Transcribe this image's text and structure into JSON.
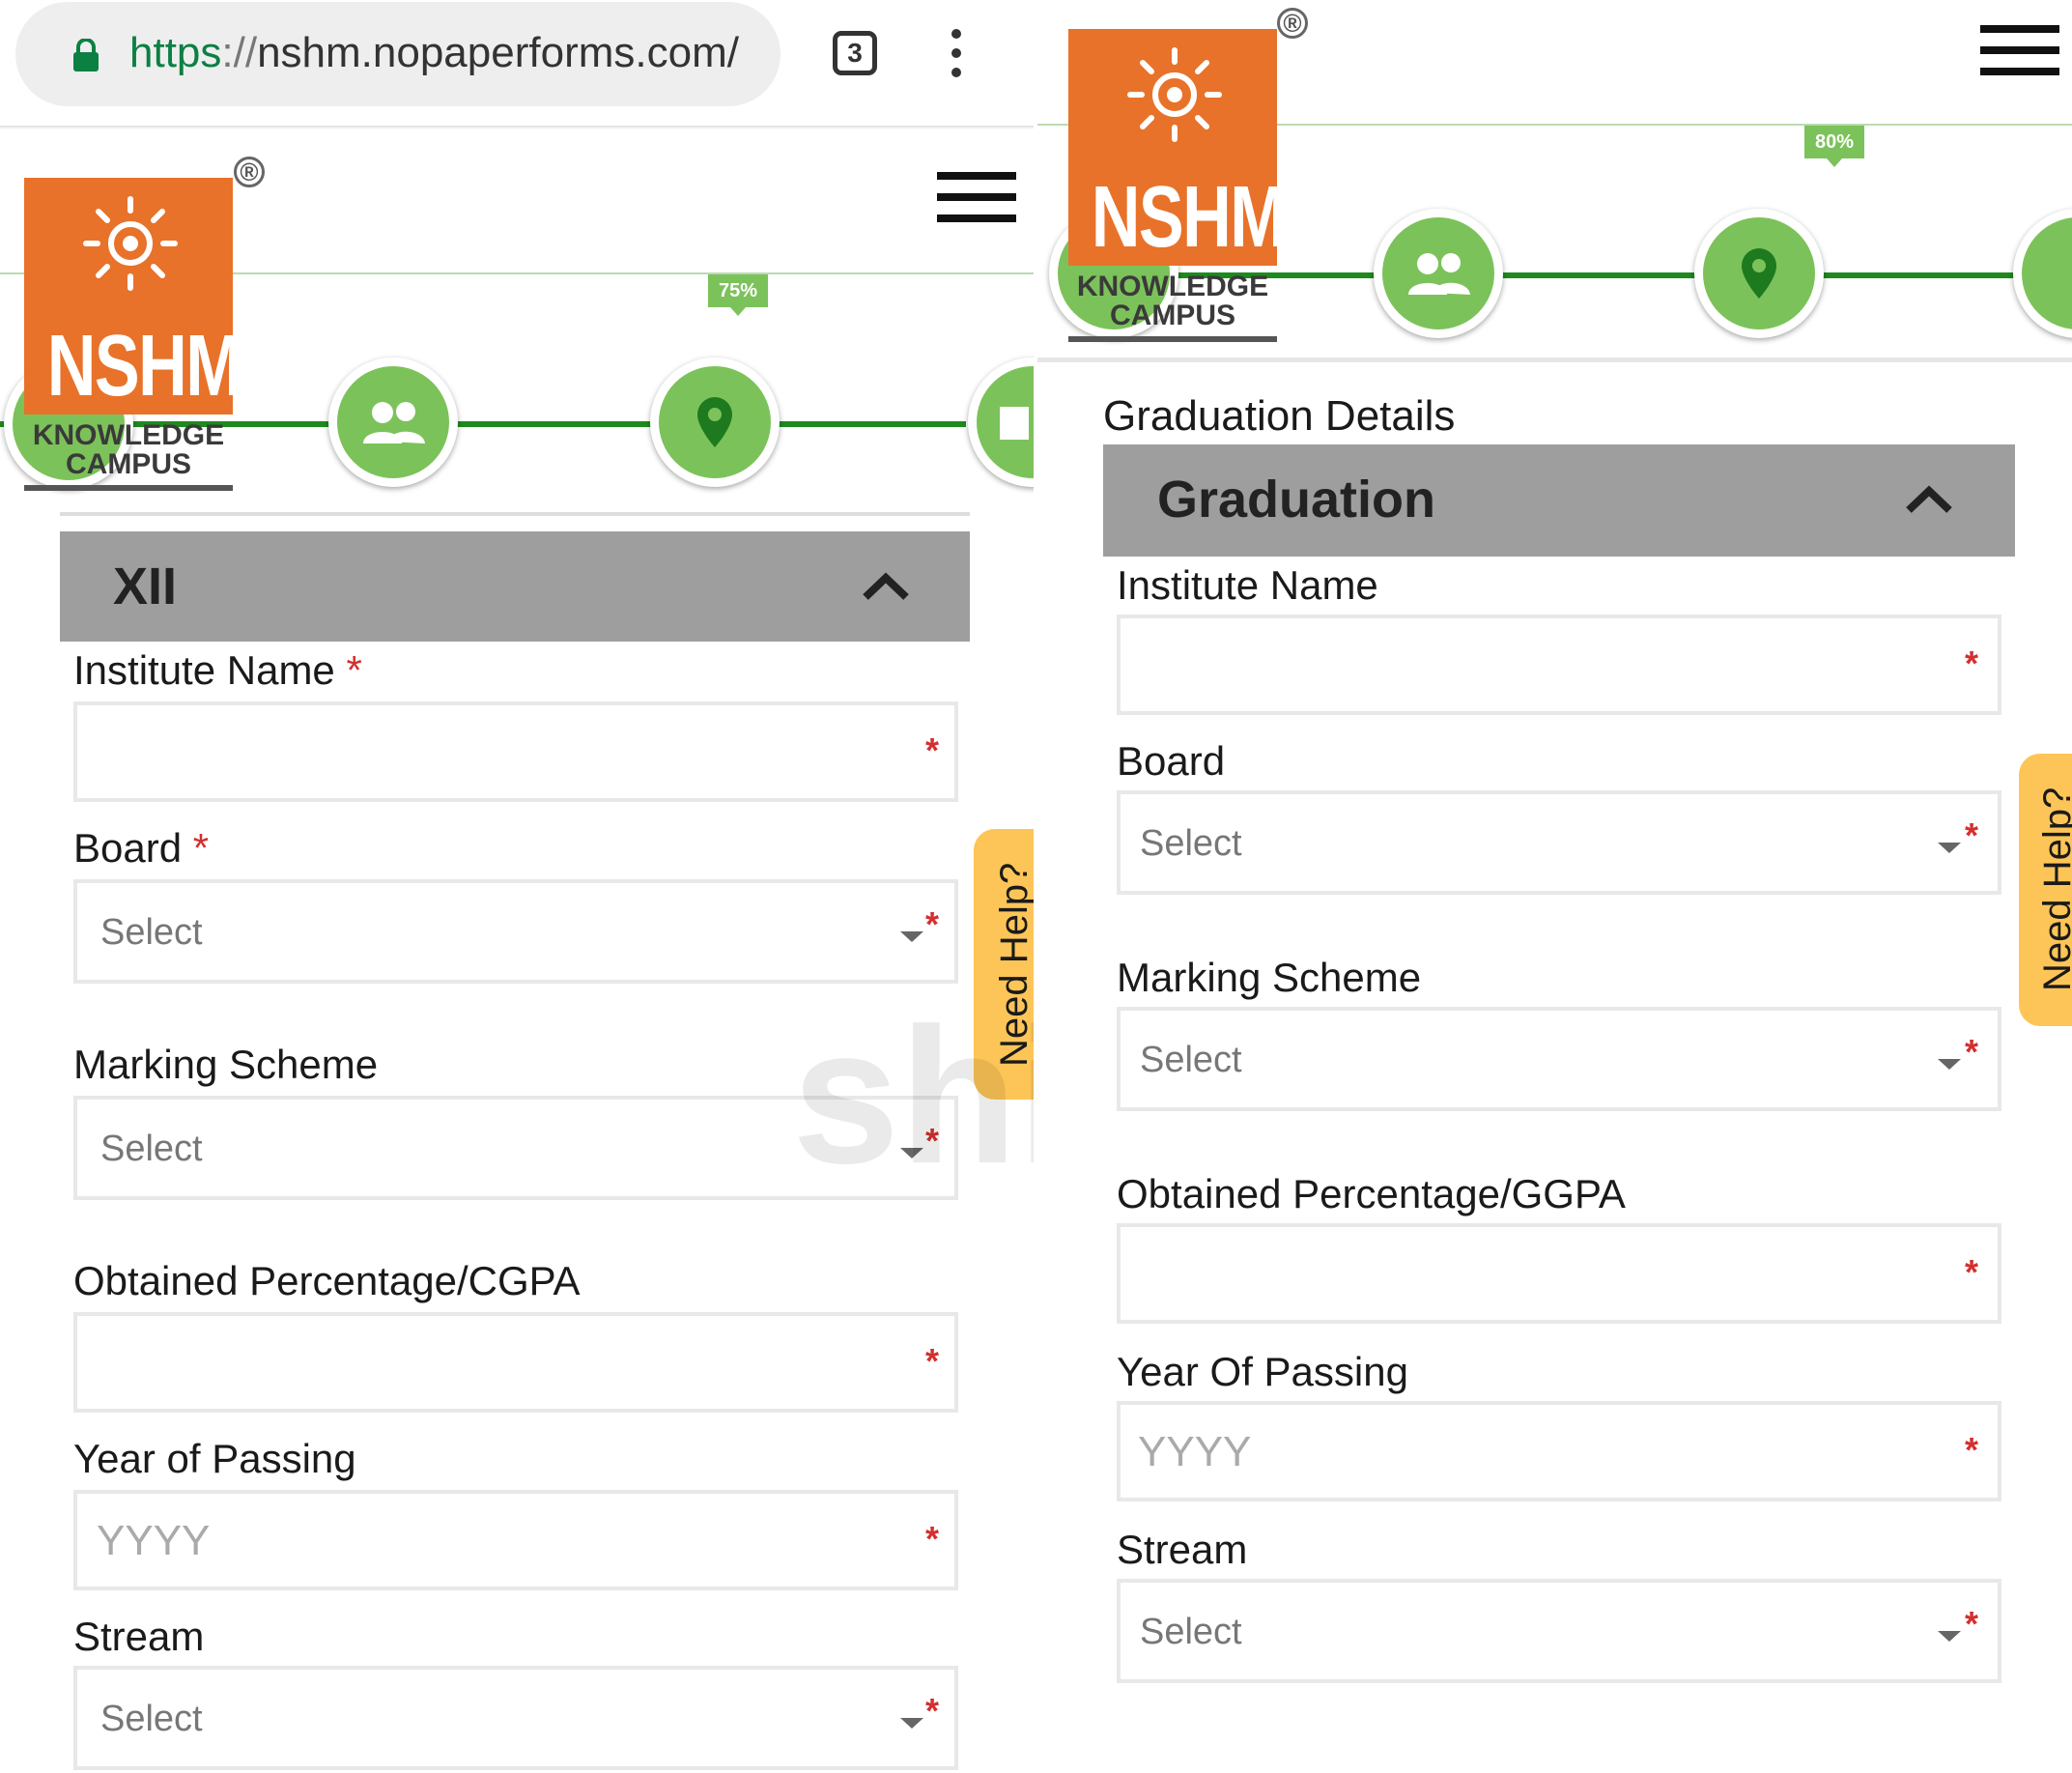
{
  "browser": {
    "url_scheme": "https",
    "url_sep": "://",
    "url_host": "nshm.nopaperforms.com/",
    "tab_count": "3"
  },
  "brand": {
    "logo_text": "NSHM",
    "logo_sub1": "KNOWLEDGE",
    "logo_sub2": "CAMPUS",
    "registered": "®",
    "accent": "#e8722a",
    "step_green": "#7cc25a",
    "line_green": "#1e8a1e",
    "help_yellow": "#fdc557"
  },
  "left": {
    "progress_label": "75%",
    "section_header": "XII",
    "fields": {
      "institute_label": "Institute Name",
      "institute_req": "*",
      "board_label": "Board",
      "board_req": "*",
      "board_placeholder": "Select",
      "marking_label": "Marking Scheme",
      "marking_placeholder": "Select",
      "percent_label": "Obtained Percentage/CGPA",
      "year_label": "Year of Passing",
      "year_placeholder": "YYYY",
      "stream_label": "Stream",
      "stream_placeholder": "Select",
      "star": "*"
    },
    "help": "Need Help?"
  },
  "right": {
    "progress_label": "80%",
    "section_title": "Graduation Details",
    "section_header": "Graduation",
    "fields": {
      "institute_label": "Institute Name",
      "board_label": "Board",
      "board_placeholder": "Select",
      "marking_label": "Marking Scheme",
      "marking_placeholder": "Select",
      "percent_label": "Obtained Percentage/GGPA",
      "year_label": "Year Of Passing",
      "year_placeholder": "YYYY",
      "stream_label": "Stream",
      "stream_placeholder": "Select",
      "star": "*"
    },
    "help": "Need Help?"
  },
  "watermark": "shiksha",
  "icons": [
    "lock-icon",
    "kebab-menu-icon",
    "hamburger-menu-icon",
    "people-icon",
    "location-pin-icon",
    "document-icon",
    "chevron-up-icon",
    "dropdown-caret-icon"
  ]
}
